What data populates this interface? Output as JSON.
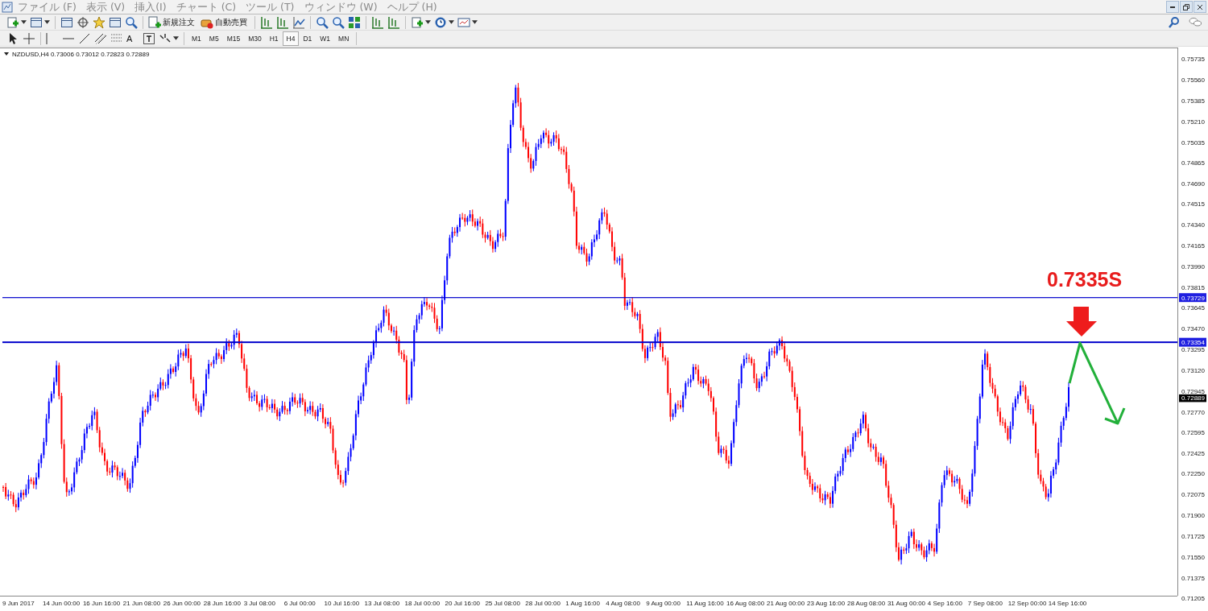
{
  "menu": [
    "ファイル (F)",
    "表示 (V)",
    "挿入(I)",
    "チャート (C)",
    "ツール (T)",
    "ウィンドウ (W)",
    "ヘルプ (H)"
  ],
  "toolbar": {
    "order_button": "新規注文",
    "autotrade_button": "自動売買"
  },
  "drawing_tools": {
    "text_tool": "A"
  },
  "timeframes": [
    {
      "label": "M1",
      "selected": false
    },
    {
      "label": "M5",
      "selected": false
    },
    {
      "label": "M15",
      "selected": false
    },
    {
      "label": "M30",
      "selected": false
    },
    {
      "label": "H1",
      "selected": false
    },
    {
      "label": "H4",
      "selected": true
    },
    {
      "label": "D1",
      "selected": false
    },
    {
      "label": "W1",
      "selected": false
    },
    {
      "label": "MN",
      "selected": false
    }
  ],
  "chart": {
    "header": "NZDUSD,H4  0.73006 0.73012 0.72823 0.72889",
    "price_axis": [
      "0.75735",
      "0.75560",
      "0.75385",
      "0.75210",
      "0.75035",
      "0.74865",
      "0.74690",
      "0.74515",
      "0.74340",
      "0.74165",
      "0.73990",
      "0.73815",
      "0.73645",
      "0.73470",
      "0.73295",
      "0.73120",
      "0.72945",
      "0.72770",
      "0.72595",
      "0.72425",
      "0.72250",
      "0.72075",
      "0.71900",
      "0.71725",
      "0.71550",
      "0.71375",
      "0.71205"
    ],
    "levels": [
      {
        "label": "0.73729",
        "thick": false
      },
      {
        "label": "0.73354",
        "thick": true
      }
    ],
    "current_price": "0.72889",
    "time_axis": [
      "9 Jun 2017",
      "14 Jun 00:00",
      "16 Jun 16:00",
      "21 Jun 08:00",
      "26 Jun 00:00",
      "28 Jun 16:00",
      "3 Jul 08:00",
      "6 Jul 00:00",
      "10 Jul 16:00",
      "13 Jul 08:00",
      "18 Jul 00:00",
      "20 Jul 16:00",
      "25 Jul 08:00",
      "28 Jul 00:00",
      "1 Aug 16:00",
      "4 Aug 08:00",
      "9 Aug 00:00",
      "11 Aug 16:00",
      "16 Aug 08:00",
      "21 Aug 00:00",
      "23 Aug 16:00",
      "28 Aug 08:00",
      "31 Aug 00:00",
      "4 Sep 16:00",
      "7 Sep 08:00",
      "12 Sep 00:00",
      "14 Sep 16:00"
    ],
    "annotation": "0.7335S"
  }
}
